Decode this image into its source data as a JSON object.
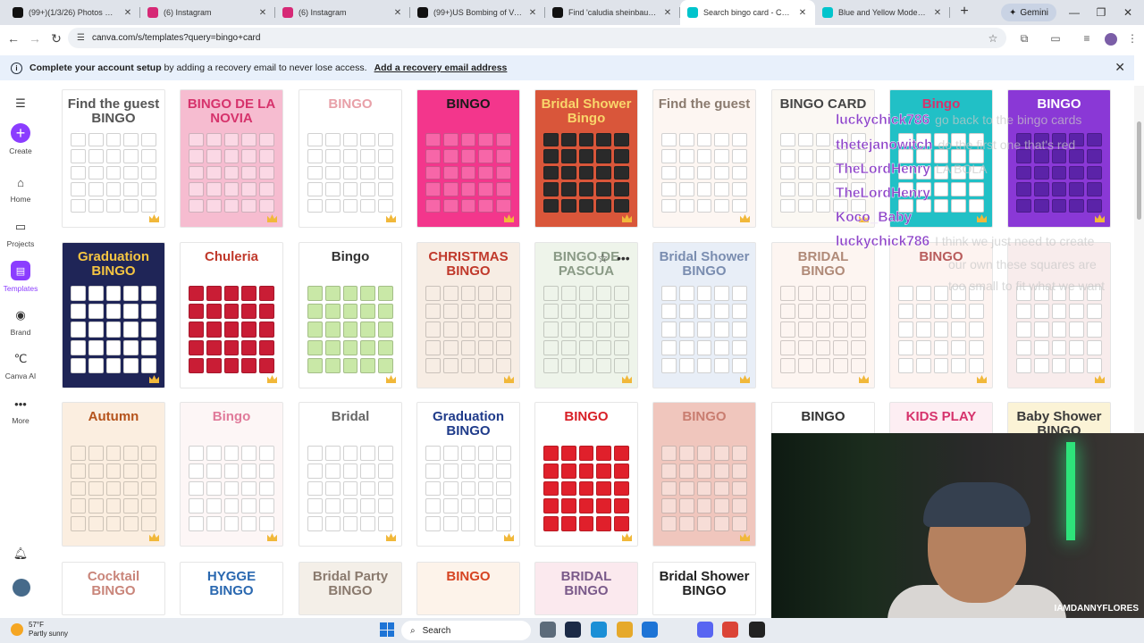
{
  "browser": {
    "tabs": [
      {
        "title": "(99+)(1/3/26) Photos obtaine",
        "icon": "tiktok-icon",
        "color": "#111111"
      },
      {
        "title": "(6) Instagram",
        "icon": "instagram-icon",
        "color": "#d62976"
      },
      {
        "title": "(6) Instagram",
        "icon": "instagram-icon",
        "color": "#d62976"
      },
      {
        "title": "(99+)US Bombing of Venezu",
        "icon": "tiktok-icon",
        "color": "#111111"
      },
      {
        "title": "Find 'caludia sheinbaum trun",
        "icon": "tiktok-icon",
        "color": "#111111"
      },
      {
        "title": "Search bingo card - Canva",
        "icon": "canva-icon",
        "color": "#00c4cc"
      },
      {
        "title": "Blue and Yellow Modern Brig",
        "icon": "canva-icon",
        "color": "#00c4cc"
      }
    ],
    "active_tab": 5,
    "gemini_label": "Gemini",
    "url": "canva.com/s/templates?query=bingo+card"
  },
  "banner": {
    "bold": "Complete your account setup",
    "text": " by adding a recovery email to never lose access.",
    "link": "Add a recovery email address"
  },
  "sidebar": {
    "items": [
      {
        "label": "Create",
        "icon": "plus-icon"
      },
      {
        "label": "Home",
        "icon": "home-icon"
      },
      {
        "label": "Projects",
        "icon": "folder-icon"
      },
      {
        "label": "Templates",
        "icon": "templates-icon"
      },
      {
        "label": "Brand",
        "icon": "brand-icon"
      },
      {
        "label": "Canva AI",
        "icon": "canva-ai-icon"
      },
      {
        "label": "More",
        "icon": "more-icon"
      }
    ]
  },
  "templates": [
    {
      "title": "Find the guest BINGO",
      "bg": "#ffffff",
      "fg": "#555555",
      "cell": "#ffffff"
    },
    {
      "title": "BINGO DE LA NOVIA",
      "bg": "#f6bcd0",
      "fg": "#d6336c",
      "cell": "#fbd8e5"
    },
    {
      "title": "BINGO",
      "bg": "#ffffff",
      "fg": "#e8a0a8",
      "cell": "#ffffff"
    },
    {
      "title": "BINGO",
      "bg": "#f3368c",
      "fg": "#1a1a1a",
      "cell": "#f766a8"
    },
    {
      "title": "Bridal Shower Bingo",
      "bg": "#d9563a",
      "fg": "#f9d66b",
      "cell": "#2a2a2a"
    },
    {
      "title": "Find the guest",
      "bg": "#fdf6f2",
      "fg": "#8a7a6e",
      "cell": "#ffffff"
    },
    {
      "title": "BINGO CARD",
      "bg": "#fbf8f3",
      "fg": "#444444",
      "cell": "#ffffff"
    },
    {
      "title": "Bingo",
      "bg": "#21c0c6",
      "fg": "#d6336c",
      "cell": "#ffffff"
    },
    {
      "title": "BINGO",
      "bg": "#8a38d6",
      "fg": "#ffffff",
      "cell": "#5b23a8"
    },
    {
      "title": "Graduation BINGO",
      "bg": "#1f2557",
      "fg": "#f5c542",
      "cell": "#ffffff"
    },
    {
      "title": "Chuleria",
      "bg": "#ffffff",
      "fg": "#c0392b",
      "cell": "#c91d35"
    },
    {
      "title": "Bingo",
      "bg": "#ffffff",
      "fg": "#333333",
      "cell": "#c9e8a7"
    },
    {
      "title": "CHRISTMAS BINGO",
      "bg": "#f7ede4",
      "fg": "#c0392b",
      "cell": "#f7ede4"
    },
    {
      "title": "BINGO DE PASCUA",
      "bg": "#eef4ea",
      "fg": "#8a9a86",
      "cell": "#eef4ea"
    },
    {
      "title": "Bridal Shower BINGO",
      "bg": "#e8eef7",
      "fg": "#7a8db0",
      "cell": "#ffffff"
    },
    {
      "title": "BRIDAL BINGO",
      "bg": "#fdf5f1",
      "fg": "#b08a78",
      "cell": "#fdf5f1"
    },
    {
      "title": "BINGO",
      "bg": "#fdf3f0",
      "fg": "#b85c5c",
      "cell": "#ffffff"
    },
    {
      "title": "",
      "bg": "#f8ecec",
      "fg": "#b07a7a",
      "cell": "#ffffff"
    },
    {
      "title": "Autumn",
      "bg": "#fbeee0",
      "fg": "#b5531c",
      "cell": "#fbeee0"
    },
    {
      "title": "Bingo",
      "bg": "#fdf6f6",
      "fg": "#e07a9a",
      "cell": "#ffffff"
    },
    {
      "title": "Bridal",
      "bg": "#ffffff",
      "fg": "#666666",
      "cell": "#ffffff"
    },
    {
      "title": "Graduation BINGO",
      "bg": "#ffffff",
      "fg": "#1f3b8a",
      "cell": "#ffffff"
    },
    {
      "title": "BINGO",
      "bg": "#ffffff",
      "fg": "#d81f26",
      "cell": "#e0202b"
    },
    {
      "title": "BINGO",
      "bg": "#f0c6bd",
      "fg": "#c97d70",
      "cell": "#f7ddd7"
    },
    {
      "title": "BINGO",
      "bg": "#ffffff",
      "fg": "#333333",
      "cell": "#ffffff"
    },
    {
      "title": "KIDS PLAY",
      "bg": "#fdeef3",
      "fg": "#d6336c",
      "cell": "#ffffff"
    },
    {
      "title": "Baby Shower BINGO",
      "bg": "#fbf3d6",
      "fg": "#3a3a3a",
      "cell": "#ffffff"
    },
    {
      "title": "Cocktail BINGO",
      "bg": "#ffffff",
      "fg": "#c9857a",
      "cell": "#ffffff"
    },
    {
      "title": "HYGGE BINGO",
      "bg": "#ffffff",
      "fg": "#2a68b0",
      "cell": "#ffffff"
    },
    {
      "title": "Bridal Party BINGO",
      "bg": "#f4efe8",
      "fg": "#8a7a6e",
      "cell": "#ffffff"
    },
    {
      "title": "BINGO",
      "bg": "#fdf3ea",
      "fg": "#d64422",
      "cell": "#ffffff"
    },
    {
      "title": "BRIDAL BINGO",
      "bg": "#fbe9ee",
      "fg": "#7a5a8a",
      "cell": "#ffffff"
    },
    {
      "title": "Bridal Shower BINGO",
      "bg": "#ffffff",
      "fg": "#222222",
      "cell": "#ffffff"
    }
  ],
  "chat": [
    {
      "user": "luckychick786",
      "text": "go back to the bingo cards"
    },
    {
      "user": "thetejanowitch",
      "text": "do the first one that's red"
    },
    {
      "user": "TheLordHenry",
      "text": "LA BOLA"
    },
    {
      "user": "TheLordHenry",
      "text": ""
    },
    {
      "user": "Koco_Baby",
      "text": ""
    },
    {
      "user": "luckychick786",
      "text": "I think we just need to create"
    },
    {
      "user": "",
      "text": "our own these squares are"
    },
    {
      "user": "",
      "text": "too small to fit what we want"
    }
  ],
  "webcam": {
    "handle": "IAMDANNYFLORES"
  },
  "taskbar": {
    "temp": "57°F",
    "weather": "Partly sunny",
    "search": "Search",
    "apps": [
      {
        "icon": "file-explorer-icon",
        "color": "#5c6b7a"
      },
      {
        "icon": "photoshop-icon",
        "color": "#1b2a46"
      },
      {
        "icon": "edge-icon",
        "color": "#1b8fd6"
      },
      {
        "icon": "files-icon",
        "color": "#e6a92b"
      },
      {
        "icon": "store-icon",
        "color": "#1e74d6"
      },
      {
        "icon": "discord-icon",
        "color": "#5865f2"
      },
      {
        "icon": "chrome-icon",
        "color": "#db4437"
      },
      {
        "icon": "obs-icon",
        "color": "#222222"
      }
    ]
  }
}
